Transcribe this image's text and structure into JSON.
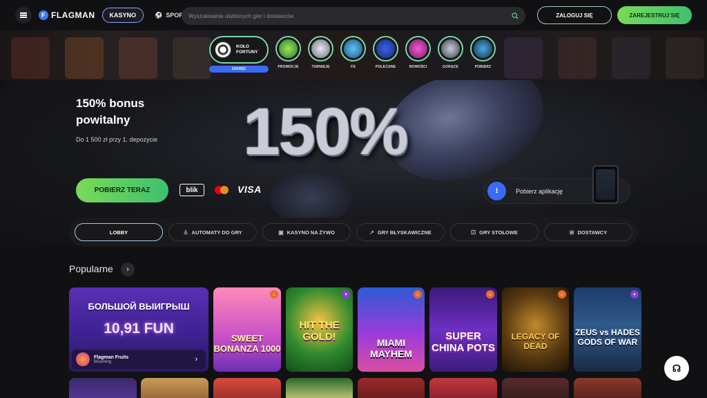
{
  "header": {
    "logo": "FLAGMAN",
    "tab_casino": "KASYNO",
    "tab_sport": "SPORT",
    "search_placeholder": "Wyszukiwanie ulubionych gier i dostawców",
    "login": "ZALOGUJ SIĘ",
    "register": "ZAREJESTRUJ SIĘ"
  },
  "wheel": {
    "line1": "KOŁO",
    "line2": "FORTUNY",
    "button": "ZAKRĘC"
  },
  "promo_items": [
    {
      "label": "PROMOCJE",
      "icon": "gift-icon"
    },
    {
      "label": "TURNIEJE",
      "icon": "trophy-icon"
    },
    {
      "label": "FS",
      "icon": "freespins-icon"
    },
    {
      "label": "POLECANE",
      "icon": "bag-icon"
    },
    {
      "label": "NOWOŚCI",
      "icon": "stars-icon"
    },
    {
      "label": "GORĄCE",
      "icon": "rocket-icon"
    },
    {
      "label": "POBIERZ",
      "icon": "download-icon"
    }
  ],
  "hero": {
    "title": "150% bonus powitalny",
    "subtitle": "Do 1 500 zł przy 1. depozycie",
    "big_text": "150%",
    "cta": "POBIERZ TERAZ",
    "pay_blik": "blik",
    "pay_visa": "VISA",
    "app_label": "Pobierz aplikację"
  },
  "categories": [
    {
      "label": "LOBBY",
      "icon": "",
      "active": true
    },
    {
      "label": "AUTOMATY DO GRY",
      "icon": "♙"
    },
    {
      "label": "KASYNO NA ŻYWO",
      "icon": "▣"
    },
    {
      "label": "GRY BŁYSKAWICZNE",
      "icon": "↗"
    },
    {
      "label": "GRY STOŁOWE",
      "icon": "⚀"
    },
    {
      "label": "DOSTAWCY",
      "icon": "⊞"
    }
  ],
  "popular": {
    "title": "Popularne",
    "feature": {
      "headline": "БОЛЬШОЙ ВЫИГРЫШ",
      "amount": "10,91 FUN",
      "name": "Flagman Fruits",
      "provider": "BGaming"
    },
    "games": [
      {
        "title": "SWEET BONANZA 1000"
      },
      {
        "title": "HIT THE GOLD!"
      },
      {
        "title": "MIAMI MAYHEM"
      },
      {
        "title": "SUPER CHINA POTS"
      },
      {
        "title": "LEGACY OF DEAD"
      },
      {
        "title": "ZEUS vs HADES GODS OF WAR"
      }
    ]
  },
  "colors": {
    "accent_green": "#7bd957",
    "accent_blue": "#3b6bf5",
    "bg": "#111113"
  }
}
